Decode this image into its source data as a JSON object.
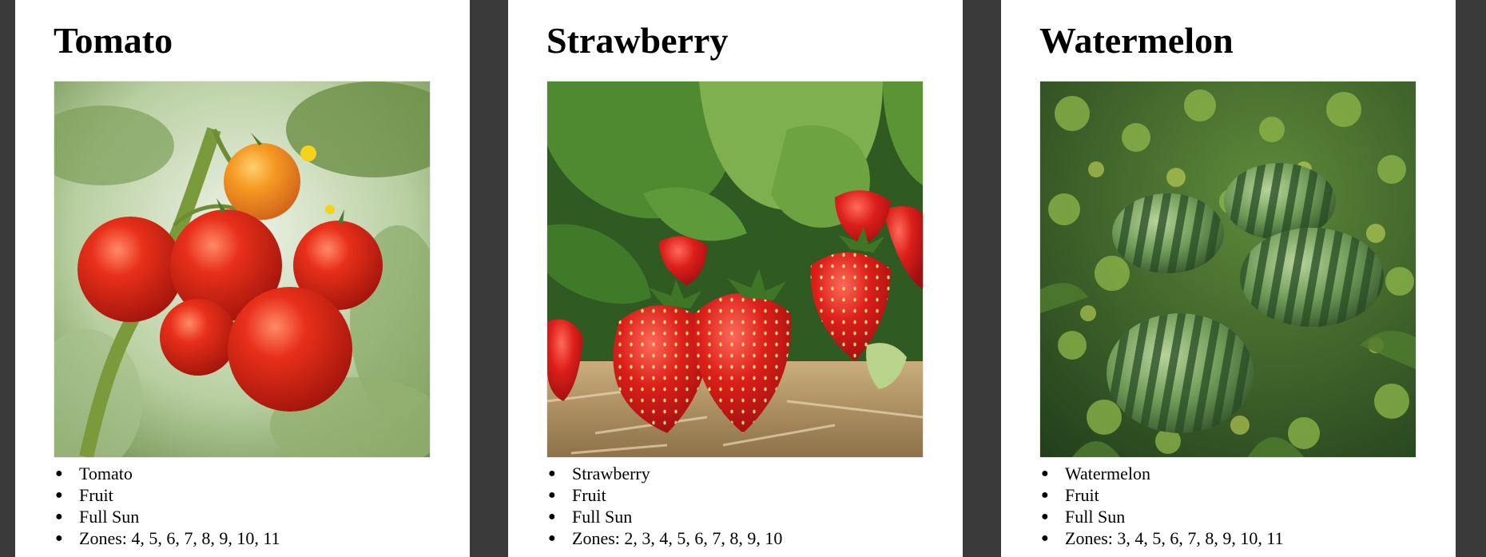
{
  "cards": [
    {
      "title": "Tomato",
      "image": "tomato-photo",
      "details": [
        "Tomato",
        "Fruit",
        "Full Sun",
        "Zones: 4, 5, 6, 7, 8, 9, 10, 11"
      ]
    },
    {
      "title": "Strawberry",
      "image": "strawberry-photo",
      "details": [
        "Strawberry",
        "Fruit",
        "Full Sun",
        "Zones: 2, 3, 4, 5, 6, 7, 8, 9, 10"
      ]
    },
    {
      "title": "Watermelon",
      "image": "watermelon-photo",
      "details": [
        "Watermelon",
        "Fruit",
        "Full Sun",
        "Zones: 3, 4, 5, 6, 7, 8, 9, 10, 11"
      ]
    }
  ],
  "colors": {
    "page_background": "#3a3a3a",
    "card_background": "#ffffff",
    "text": "#000000"
  }
}
